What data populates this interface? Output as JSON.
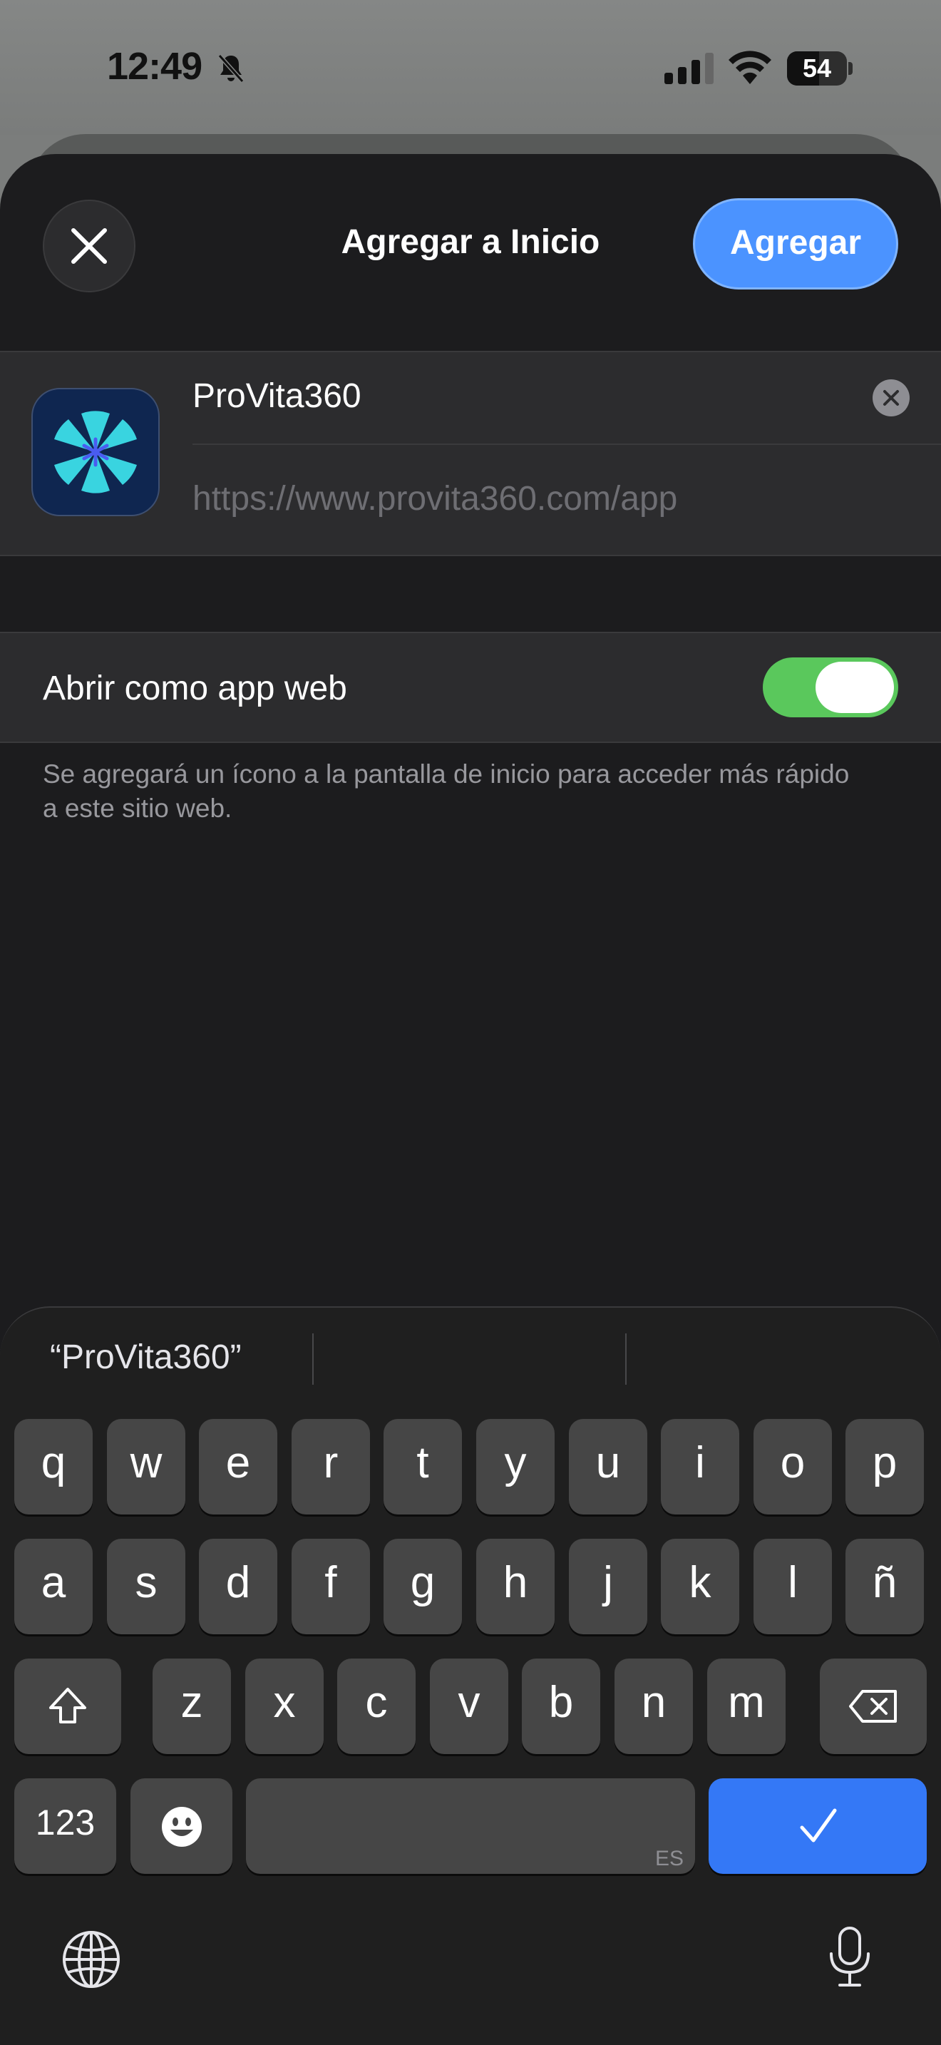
{
  "status_bar": {
    "time": "12:49",
    "battery": "54",
    "battery_level": 0.54
  },
  "header": {
    "title": "Agregar a Inicio",
    "add_label": "Agregar"
  },
  "shortcut": {
    "name": "ProVita360",
    "url": "https://www.provita360.com/app"
  },
  "web_app": {
    "label": "Abrir como app web",
    "enabled": true,
    "footer": "Se agregará un ícono a la pantalla de inicio para acceder más rápido a este sitio web."
  },
  "keyboard": {
    "suggestion": "“ProVita360”",
    "rows": [
      [
        "q",
        "w",
        "e",
        "r",
        "t",
        "y",
        "u",
        "i",
        "o",
        "p"
      ],
      [
        "a",
        "s",
        "d",
        "f",
        "g",
        "h",
        "j",
        "k",
        "l",
        "ñ"
      ],
      [
        "z",
        "x",
        "c",
        "v",
        "b",
        "n",
        "m"
      ]
    ],
    "numbers_label": "123",
    "language": "ES"
  },
  "colors": {
    "accent": "#4b93ff",
    "toggle_on": "#5ac85c",
    "return_key": "#3478f6"
  },
  "icons": [
    "bell-slash-icon",
    "signal-icon",
    "wifi-icon",
    "battery-icon",
    "close-icon",
    "clear-icon",
    "shift-icon",
    "delete-icon",
    "emoji-icon",
    "checkmark-icon",
    "globe-icon",
    "microphone-icon"
  ]
}
